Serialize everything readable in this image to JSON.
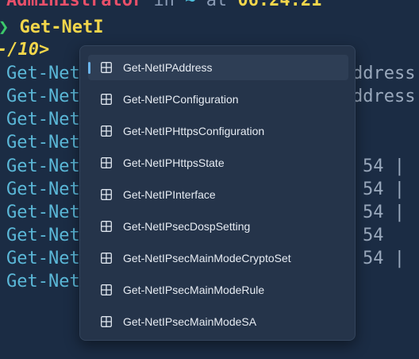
{
  "prompt": {
    "user": "Administrator",
    "in": "in",
    "dir": "~",
    "at": "at",
    "time": "06:24:21"
  },
  "command": {
    "arrow": "❯",
    "text": "Get-NetI"
  },
  "completion_count": "-/10>",
  "output_rows": [
    {
      "left": "Get-Net",
      "right": "ddress"
    },
    {
      "left": "Get-Net",
      "right": "ddress"
    },
    {
      "left": "Get-Net",
      "right": ""
    },
    {
      "left": "Get-Net",
      "right": ""
    },
    {
      "left": "Get-Net",
      "right": "54 | "
    },
    {
      "left": "Get-Net",
      "right": "54 | "
    },
    {
      "left": "Get-Net",
      "right": "54 | "
    },
    {
      "left": "Get-Net",
      "right": "54"
    },
    {
      "left": "Get-Net",
      "right": "54 |"
    },
    {
      "left": "Get-Net",
      "right": ""
    }
  ],
  "suggestions": {
    "icon": "function-icon",
    "accent_color": "#6bb4ea",
    "items": [
      {
        "label": "Get-NetIPAddress",
        "selected": true
      },
      {
        "label": "Get-NetIPConfiguration",
        "selected": false
      },
      {
        "label": "Get-NetIPHttpsConfiguration",
        "selected": false
      },
      {
        "label": "Get-NetIPHttpsState",
        "selected": false
      },
      {
        "label": "Get-NetIPInterface",
        "selected": false
      },
      {
        "label": "Get-NetIPsecDospSetting",
        "selected": false
      },
      {
        "label": "Get-NetIPsecMainModeCryptoSet",
        "selected": false
      },
      {
        "label": "Get-NetIPsecMainModeRule",
        "selected": false
      },
      {
        "label": "Get-NetIPsecMainModeSA",
        "selected": false
      }
    ]
  }
}
